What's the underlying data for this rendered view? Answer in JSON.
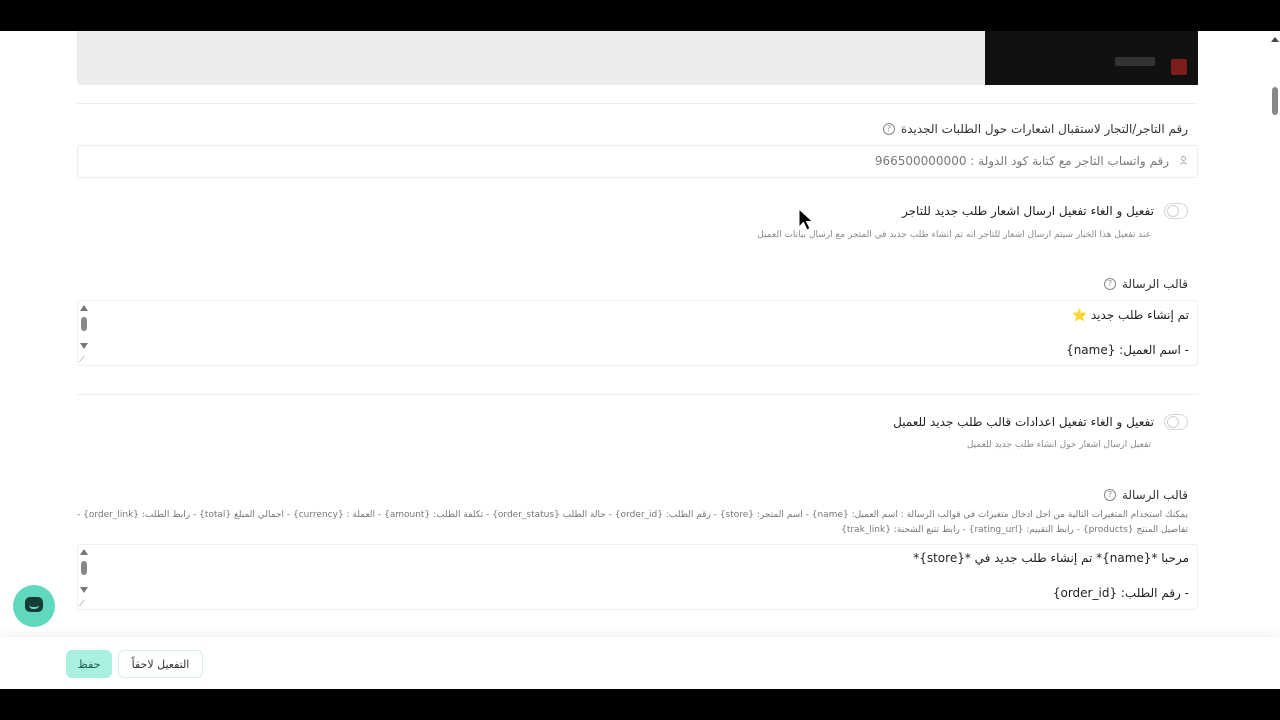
{
  "merchant_section": {
    "label": "رقم التاجر/التجار لاستقبال اشعارات حول الطلبات الجديدة",
    "help_icon": "?",
    "input_placeholder": "رقم واتساب التاجر مع كتابة كود الدولة : 966500000000",
    "toggle_title": "تفعيل و الغاء تفعيل ارسال اشعار طلب جديد للتاجر",
    "toggle_on": false,
    "toggle_description": "عند تفعيل هذا الخيار سيتم ارسال اشعار للتاجر انه تم انشاء طلب جديد في المتجر مع ارسال بيانات العميل",
    "template_label": "قالب الرسالة",
    "template_lines": [
      "تم إنشاء طلب جديد ⭐",
      "",
      "- اسم العميل: {name}"
    ]
  },
  "customer_section": {
    "toggle_title": "تفعيل و الغاء تفعيل اعدادات قالب طلب جديد للعميل",
    "toggle_on": false,
    "toggle_description": "تفعيل ارسال اشعار حول انشاء طلب جديد للعميل",
    "template_label": "قالب الرسالة",
    "variables_line1": "يمكنك استخدام المتغيرات التالية من اجل ادخال متغيرات في قوالب الرسالة : اسم العميل: {name} - اسم المتجر: {store} - رقم الطلب: {order_id} - حالة الطلب {order_status} - تكلفة الطلب: {amount} - العملة : {currency} - اجمالي المبلغ {total} - رابط الطلب: {order_link} -",
    "variables_line2": "تفاصيل المنتج {products} - رابط التقييم: {rating_url} - رابط تتبع الشحنة: {trak_link}",
    "template_lines": [
      "مرحبا *{name}* تم إنشاء طلب جديد في *{store}*",
      "",
      "- رقم الطلب: {order_id}"
    ]
  },
  "footer": {
    "save_label": "حفظ",
    "later_label": "التفعيل لاحقاً"
  },
  "colors": {
    "accent": "#a8f0df",
    "chat_bubble": "#5fd8bd"
  }
}
